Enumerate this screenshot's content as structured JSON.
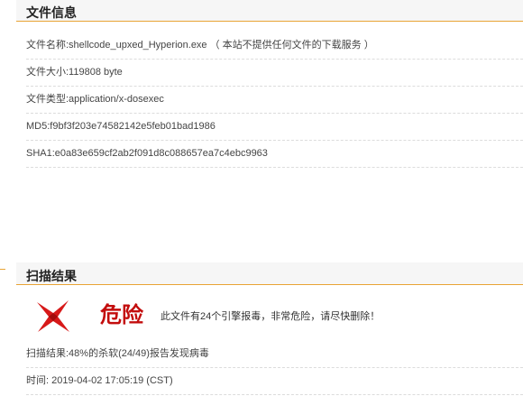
{
  "file_info": {
    "title": "文件信息",
    "rows": [
      {
        "label": "文件名称",
        "value": ":shellcode_upxed_Hyperion.exe （ 本站不提供任何文件的下载服务 ）"
      },
      {
        "label": "文件大小",
        "value": ":119808 byte"
      },
      {
        "label": "文件类型",
        "value": ":application/x-dosexec"
      },
      {
        "label": "MD5",
        "value": ":f9bf3f203e74582142e5feb01bad1986"
      },
      {
        "label": "SHA1",
        "value": ":e0a83e659cf2ab2f091d8c088657ea7c4ebc9963"
      }
    ]
  },
  "scan_result": {
    "title": "扫描结果",
    "danger_label": "危险",
    "danger_desc": "此文件有24个引擎报毒，非常危险，请尽快删除！",
    "summary": "扫描结果:48%的杀软(24/49)报告发现病毒",
    "time": "时间: 2019-04-02 17:05:19 (CST)",
    "detection_percent": 48
  },
  "colors": {
    "accent": "#e8a435",
    "danger": "#c30d0d"
  }
}
